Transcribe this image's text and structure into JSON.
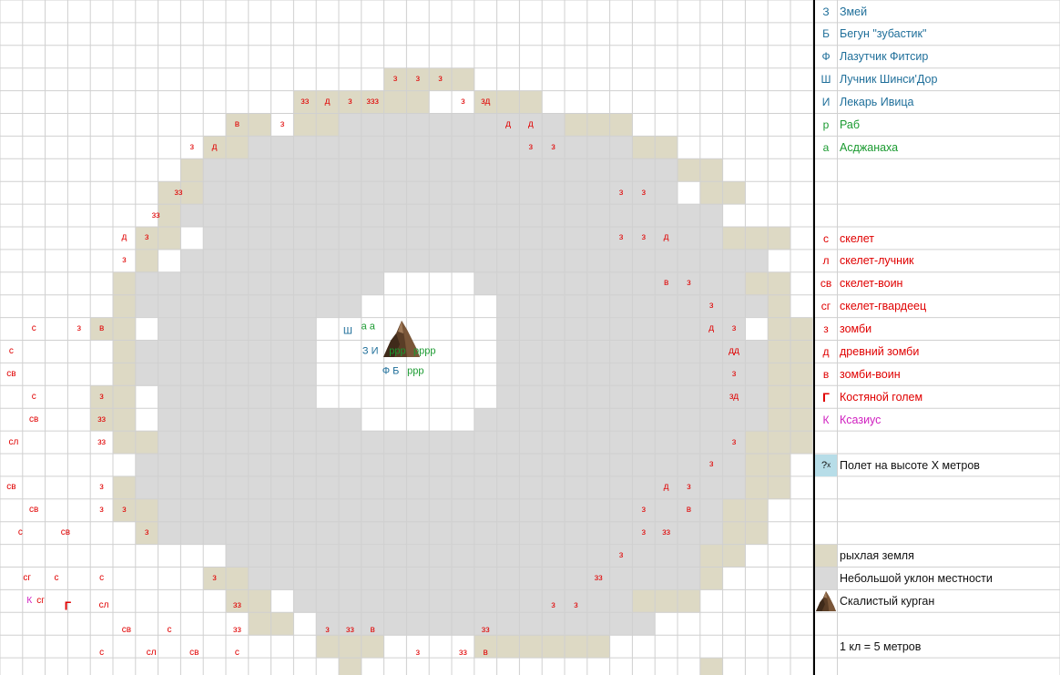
{
  "colors": {
    "grid_line": "#d0d0d0",
    "loose_earth": "#ddd9c4",
    "slope": "#d9d9d9",
    "flight": "#b7dde8",
    "enemy": "#e00000",
    "ally_blue": "#1f6f9a",
    "ally_green": "#1a9a30",
    "boss_magenta": "#d020c0"
  },
  "map": {
    "rows": [
      "....................................",
      "....................................",
      "....................................",
      ".................EEEE...............",
      ".............EEEEEE..EEE............",
      "..........EE.EEGGGGGGGGGGEEE........",
      ".........EEGGGGGGGGGGGGGGGGGEE......",
      "........EGGGGGGGGGGGGGGGGGGGGGEE....",
      ".......EEGGGGGGGGGGGGGGGGGGGGG.EE...",
      ".......EGGGGGGGGGGGGGGGGGGGGGGGG....",
      "......EE.GGGGGGGGGGGGGGGGGGGGGGGEEE.",
      "......E.GGGGGGGGGGGGGGGGGGGGGGGGGG..",
      ".....EGGGGGGGGGGGWWWWGGGGGGGGGGGGEE.",
      ".....EGGGGGGGGGGWWWWWWGGGGGGGGGGGGE.",
      "....EE.GGGGGGGWWWWWWWWGGGGGGGGGGG.EE",
      ".....EGGGGGGGGWWWWWWWWGGGGGGGGGGGGEE",
      ".....EGGGGGGGGWWWWWWWWGGGGGGGGGGGGEE",
      "....EE.GGGGGGGWWWWWWWWGGGGGGGGGGGGEE",
      "....EE.GGGGGGGGGWWWWWGGGGGGGGGGGGGEE",
      ".....EEGGGGGGGGGGGGGGGGGGGGGGGGGGEEE",
      "......GGGGGGGGGGGGGGGGGGGGGGGGGGGEE.",
      ".....EGGGGGGGGGGGGGGGGGGGGGGGGGGGEE.",
      ".....EEGGGGGGGGGGGGGGGGGGGGGGGGGEE..",
      "......EGGGGGGGGGGGGGGGGGGGGGGGGGEE..",
      "..........GGGGGGGGGGGGGGGGGGGGGEE...",
      ".........EEGGGGGGGGGGGGGGGGGGGGE....",
      "..........EE.GGGGGGGGGGGGGGGEEE.....",
      "...........EE.GGGGGGGGGGGGGGG.......",
      "..............EEE....EEEEEE.........",
      "...............E...............E...."
    ],
    "tokens": [
      {
        "c": 17.5,
        "r": 3.5,
        "t": "з",
        "k": "e"
      },
      {
        "c": 18.5,
        "r": 3.5,
        "t": "з",
        "k": "e"
      },
      {
        "c": 19.5,
        "r": 3.5,
        "t": "з",
        "k": "e"
      },
      {
        "c": 13.5,
        "r": 4.5,
        "t": "зз",
        "k": "e"
      },
      {
        "c": 14.5,
        "r": 4.5,
        "t": "д",
        "k": "e"
      },
      {
        "c": 15.5,
        "r": 4.5,
        "t": "з",
        "k": "e"
      },
      {
        "c": 16.5,
        "r": 4.5,
        "t": "ззз",
        "k": "e"
      },
      {
        "c": 20.5,
        "r": 4.5,
        "t": "з",
        "k": "e"
      },
      {
        "c": 21.5,
        "r": 4.5,
        "t": "зд",
        "k": "e"
      },
      {
        "c": 10.5,
        "r": 5.5,
        "t": "в",
        "k": "e"
      },
      {
        "c": 12.5,
        "r": 5.5,
        "t": "з",
        "k": "e"
      },
      {
        "c": 22.5,
        "r": 5.5,
        "t": "д",
        "k": "e"
      },
      {
        "c": 23.5,
        "r": 5.5,
        "t": "д",
        "k": "e"
      },
      {
        "c": 8.5,
        "r": 6.5,
        "t": "з",
        "k": "e"
      },
      {
        "c": 9.5,
        "r": 6.5,
        "t": "д",
        "k": "e"
      },
      {
        "c": 23.5,
        "r": 6.5,
        "t": "з",
        "k": "e"
      },
      {
        "c": 24.5,
        "r": 6.5,
        "t": "з",
        "k": "e"
      },
      {
        "c": 7.9,
        "r": 8.5,
        "t": "зз",
        "k": "e"
      },
      {
        "c": 27.5,
        "r": 8.5,
        "t": "з",
        "k": "e"
      },
      {
        "c": 28.5,
        "r": 8.5,
        "t": "з",
        "k": "e"
      },
      {
        "c": 6.9,
        "r": 9.5,
        "t": "зз",
        "k": "e"
      },
      {
        "c": 5.5,
        "r": 10.5,
        "t": "д",
        "k": "e"
      },
      {
        "c": 6.5,
        "r": 10.5,
        "t": "з",
        "k": "e"
      },
      {
        "c": 27.5,
        "r": 10.5,
        "t": "з",
        "k": "e"
      },
      {
        "c": 28.5,
        "r": 10.5,
        "t": "з",
        "k": "e"
      },
      {
        "c": 29.5,
        "r": 10.5,
        "t": "д",
        "k": "e"
      },
      {
        "c": 5.5,
        "r": 11.5,
        "t": "з",
        "k": "e"
      },
      {
        "c": 29.5,
        "r": 12.5,
        "t": "в",
        "k": "e"
      },
      {
        "c": 30.5,
        "r": 12.5,
        "t": "з",
        "k": "e"
      },
      {
        "c": 31.5,
        "r": 13.5,
        "t": "з",
        "k": "e"
      },
      {
        "c": 1.5,
        "r": 14.5,
        "t": "с",
        "k": "e"
      },
      {
        "c": 3.5,
        "r": 14.5,
        "t": "з",
        "k": "e"
      },
      {
        "c": 4.5,
        "r": 14.5,
        "t": "в",
        "k": "e"
      },
      {
        "c": 31.5,
        "r": 14.5,
        "t": "д",
        "k": "e"
      },
      {
        "c": 32.5,
        "r": 14.5,
        "t": "з",
        "k": "e"
      },
      {
        "c": 0.5,
        "r": 15.5,
        "t": "с",
        "k": "e"
      },
      {
        "c": 32.5,
        "r": 15.5,
        "t": "дд",
        "k": "e"
      },
      {
        "c": 0.5,
        "r": 16.5,
        "t": "св",
        "k": "e"
      },
      {
        "c": 32.5,
        "r": 16.5,
        "t": "з",
        "k": "e"
      },
      {
        "c": 1.5,
        "r": 17.5,
        "t": "с",
        "k": "e"
      },
      {
        "c": 4.5,
        "r": 17.5,
        "t": "з",
        "k": "e"
      },
      {
        "c": 32.5,
        "r": 17.5,
        "t": "зд",
        "k": "e"
      },
      {
        "c": 1.5,
        "r": 18.5,
        "t": "св",
        "k": "e"
      },
      {
        "c": 4.5,
        "r": 18.5,
        "t": "зз",
        "k": "e"
      },
      {
        "c": 0.6,
        "r": 19.5,
        "t": "сл",
        "k": "e"
      },
      {
        "c": 4.5,
        "r": 19.5,
        "t": "зз",
        "k": "e"
      },
      {
        "c": 32.5,
        "r": 19.5,
        "t": "з",
        "k": "e"
      },
      {
        "c": 31.5,
        "r": 20.5,
        "t": "з",
        "k": "e"
      },
      {
        "c": 0.5,
        "r": 21.5,
        "t": "св",
        "k": "e"
      },
      {
        "c": 4.5,
        "r": 21.5,
        "t": "з",
        "k": "e"
      },
      {
        "c": 29.5,
        "r": 21.5,
        "t": "д",
        "k": "e"
      },
      {
        "c": 30.5,
        "r": 21.5,
        "t": "з",
        "k": "e"
      },
      {
        "c": 1.5,
        "r": 22.5,
        "t": "св",
        "k": "e"
      },
      {
        "c": 4.5,
        "r": 22.5,
        "t": "з",
        "k": "e"
      },
      {
        "c": 5.5,
        "r": 22.5,
        "t": "з",
        "k": "e"
      },
      {
        "c": 28.5,
        "r": 22.5,
        "t": "з",
        "k": "e"
      },
      {
        "c": 30.5,
        "r": 22.5,
        "t": "в",
        "k": "e"
      },
      {
        "c": 0.9,
        "r": 23.5,
        "t": "с",
        "k": "e"
      },
      {
        "c": 2.9,
        "r": 23.5,
        "t": "св",
        "k": "e"
      },
      {
        "c": 6.5,
        "r": 23.5,
        "t": "з",
        "k": "e"
      },
      {
        "c": 28.5,
        "r": 23.5,
        "t": "з",
        "k": "e"
      },
      {
        "c": 29.5,
        "r": 23.5,
        "t": "зз",
        "k": "e"
      },
      {
        "c": 27.5,
        "r": 24.5,
        "t": "з",
        "k": "e"
      },
      {
        "c": 1.2,
        "r": 25.5,
        "t": "сг",
        "k": "e"
      },
      {
        "c": 2.5,
        "r": 25.5,
        "t": "с",
        "k": "e"
      },
      {
        "c": 4.5,
        "r": 25.5,
        "t": "с",
        "k": "e"
      },
      {
        "c": 9.5,
        "r": 25.5,
        "t": "з",
        "k": "e"
      },
      {
        "c": 26.5,
        "r": 25.5,
        "t": "зз",
        "k": "e"
      },
      {
        "c": 1.3,
        "r": 26.5,
        "t": "К",
        "k": "m"
      },
      {
        "c": 1.8,
        "r": 26.5,
        "t": "сг",
        "k": "e"
      },
      {
        "c": 3.0,
        "r": 26.7,
        "t": "Г",
        "k": "eb"
      },
      {
        "c": 4.6,
        "r": 26.7,
        "t": "сл",
        "k": "e"
      },
      {
        "c": 10.5,
        "r": 26.7,
        "t": "зз",
        "k": "e"
      },
      {
        "c": 24.5,
        "r": 26.7,
        "t": "з",
        "k": "e"
      },
      {
        "c": 25.5,
        "r": 26.7,
        "t": "з",
        "k": "e"
      },
      {
        "c": 5.6,
        "r": 27.8,
        "t": "св",
        "k": "e"
      },
      {
        "c": 7.5,
        "r": 27.8,
        "t": "с",
        "k": "e"
      },
      {
        "c": 10.5,
        "r": 27.8,
        "t": "зз",
        "k": "e"
      },
      {
        "c": 14.5,
        "r": 27.8,
        "t": "з",
        "k": "e"
      },
      {
        "c": 15.5,
        "r": 27.8,
        "t": "зз",
        "k": "e"
      },
      {
        "c": 16.5,
        "r": 27.8,
        "t": "в",
        "k": "e"
      },
      {
        "c": 21.5,
        "r": 27.8,
        "t": "зз",
        "k": "e"
      },
      {
        "c": 4.5,
        "r": 28.8,
        "t": "с",
        "k": "e"
      },
      {
        "c": 6.7,
        "r": 28.8,
        "t": "сл",
        "k": "e"
      },
      {
        "c": 8.6,
        "r": 28.8,
        "t": "св",
        "k": "e"
      },
      {
        "c": 10.5,
        "r": 28.8,
        "t": "с",
        "k": "e"
      },
      {
        "c": 18.5,
        "r": 28.8,
        "t": "з",
        "k": "e"
      },
      {
        "c": 20.5,
        "r": 28.8,
        "t": "зз",
        "k": "e"
      },
      {
        "c": 21.5,
        "r": 28.8,
        "t": "в",
        "k": "e"
      },
      {
        "c": 15.4,
        "r": 14.6,
        "t": "Ш",
        "k": "ab"
      },
      {
        "c": 16.3,
        "r": 14.4,
        "t": "а а",
        "k": "ag"
      },
      {
        "c": 16.4,
        "r": 15.5,
        "t": "З И",
        "k": "ab"
      },
      {
        "c": 17.6,
        "r": 15.5,
        "t": "ррр",
        "k": "ag"
      },
      {
        "c": 18.8,
        "r": 15.5,
        "t": "рррр",
        "k": "ag"
      },
      {
        "c": 17.3,
        "r": 16.4,
        "t": "Ф  Б",
        "k": "ab"
      },
      {
        "c": 18.4,
        "r": 16.4,
        "t": "ррр",
        "k": "ag"
      }
    ],
    "barrow_icon": "rocky-barrow-icon"
  },
  "legend": {
    "items": [
      {
        "row": 0,
        "symbol": "З",
        "label": "Змей",
        "color": "#1f6f9a",
        "cls": "c-blue"
      },
      {
        "row": 1,
        "symbol": "Б",
        "label": "Бегун \"зубастик\"",
        "color": "#1f6f9a",
        "cls": "c-blue"
      },
      {
        "row": 2,
        "symbol": "Ф",
        "label": "Лазутчик Фитсир",
        "color": "#1f6f9a",
        "cls": "c-blue"
      },
      {
        "row": 3,
        "symbol": "Ш",
        "label": "Лучник Шинси'Дор",
        "color": "#1f6f9a",
        "cls": "c-blue"
      },
      {
        "row": 4,
        "symbol": "И",
        "label": "Лекарь Ивица",
        "color": "#1f6f9a",
        "cls": "c-blue"
      },
      {
        "row": 5,
        "symbol": "р",
        "label": "Раб",
        "color": "#1a9a30",
        "cls": "c-green"
      },
      {
        "row": 6,
        "symbol": "а",
        "label": "Асджанаха",
        "color": "#1a9a30",
        "cls": "c-green"
      },
      {
        "row": 10,
        "symbol": "с",
        "label": "скелет",
        "color": "#e00000",
        "cls": "c-red"
      },
      {
        "row": 11,
        "symbol": "л",
        "label": "скелет-лучник",
        "color": "#e00000",
        "cls": "c-red"
      },
      {
        "row": 12,
        "symbol": "св",
        "label": "скелет-воин",
        "color": "#e00000",
        "cls": "c-red"
      },
      {
        "row": 13,
        "symbol": "сг",
        "label": "скелет-гвардеец",
        "color": "#e00000",
        "cls": "c-red"
      },
      {
        "row": 14,
        "symbol": "з",
        "label": "зомби",
        "color": "#e00000",
        "cls": "c-red"
      },
      {
        "row": 15,
        "symbol": "д",
        "label": "древний зомби",
        "color": "#e00000",
        "cls": "c-red"
      },
      {
        "row": 16,
        "symbol": "в",
        "label": "зомби-воин",
        "color": "#e00000",
        "cls": "c-red"
      },
      {
        "row": 17,
        "symbol": "Г",
        "label": "Костяной голем",
        "color": "#e00000",
        "cls": "c-red"
      },
      {
        "row": 18,
        "symbol": "К",
        "label": "Ксазиус",
        "color": "#d020c0",
        "cls": "c-mag"
      },
      {
        "row": 20,
        "symbol": "?x",
        "label": "Полет на высоте X метров",
        "color": "#111111",
        "cls": "c-black",
        "swatch": "sw-fly"
      },
      {
        "row": 24,
        "symbol": "",
        "label": "рыхлая земля",
        "color": "#111111",
        "cls": "c-black",
        "swatch": "sw-earth"
      },
      {
        "row": 25,
        "symbol": "",
        "label": "Небольшой уклон местности",
        "color": "#111111",
        "cls": "c-black",
        "swatch": "sw-slope"
      },
      {
        "row": 26,
        "symbol": "",
        "label": "Скалистый курган",
        "color": "#111111",
        "cls": "c-black",
        "icon": "rocky-barrow-icon"
      },
      {
        "row": 28,
        "symbol": "",
        "label": "1 кл = 5 метров",
        "color": "#111111",
        "cls": "c-black"
      }
    ]
  }
}
